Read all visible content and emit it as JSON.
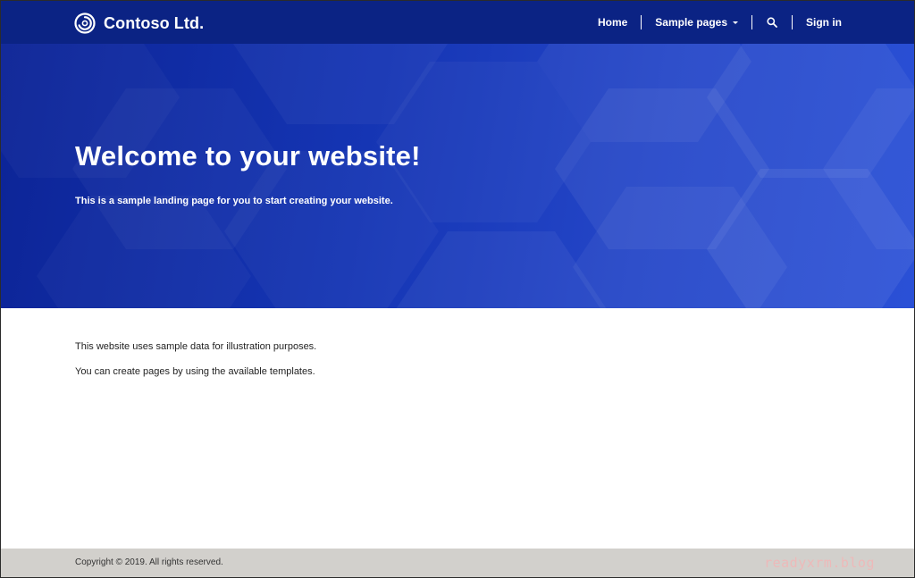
{
  "header": {
    "brand_name": "Contoso Ltd.",
    "brand_icon": "contoso-ring-logo",
    "nav": {
      "home": "Home",
      "sample_pages": "Sample pages",
      "search_icon": "search-icon",
      "sign_in": "Sign in"
    }
  },
  "hero": {
    "title": "Welcome to your website!",
    "subtitle": "This is a sample landing page for you to start creating your website."
  },
  "content": {
    "paragraphs": [
      "This website uses sample data for illustration purposes.",
      "You can create pages by using the available templates."
    ]
  },
  "footer": {
    "copyright": "Copyright © 2019. All rights reserved.",
    "watermark": "readyxrm.blog"
  },
  "colors": {
    "header_bg": "#0b2384",
    "hero_gradient_start": "#0c2496",
    "hero_gradient_end": "#2a50d6",
    "footer_bg": "#d2d0cc",
    "text_white": "#ffffff"
  }
}
